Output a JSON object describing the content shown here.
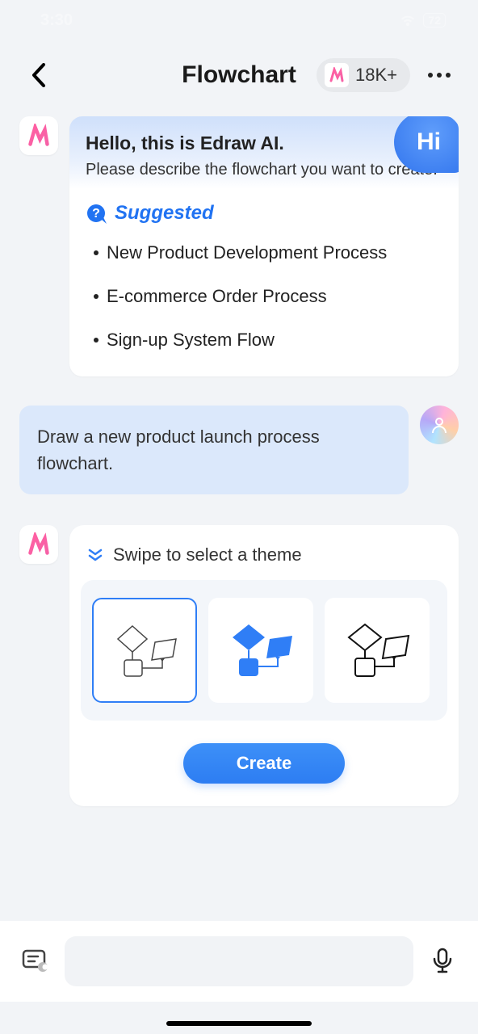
{
  "statusBar": {
    "time": "3:30",
    "battery": "72"
  },
  "header": {
    "title": "Flowchart",
    "badgeCount": "18K+"
  },
  "aiMessage": {
    "hiBubble": "Hi",
    "hello": "Hello, this is Edraw AI.",
    "prompt": "Please describe the flowchart you want to create.",
    "suggestedLabel": "Suggested",
    "suggestions": {
      "0": "New Product Development Process",
      "1": "E-commerce Order Process",
      "2": "Sign-up System Flow"
    }
  },
  "userMessage": "Draw a new product launch process flowchart.",
  "themeSection": {
    "title": "Swipe to select a theme",
    "createLabel": "Create"
  }
}
